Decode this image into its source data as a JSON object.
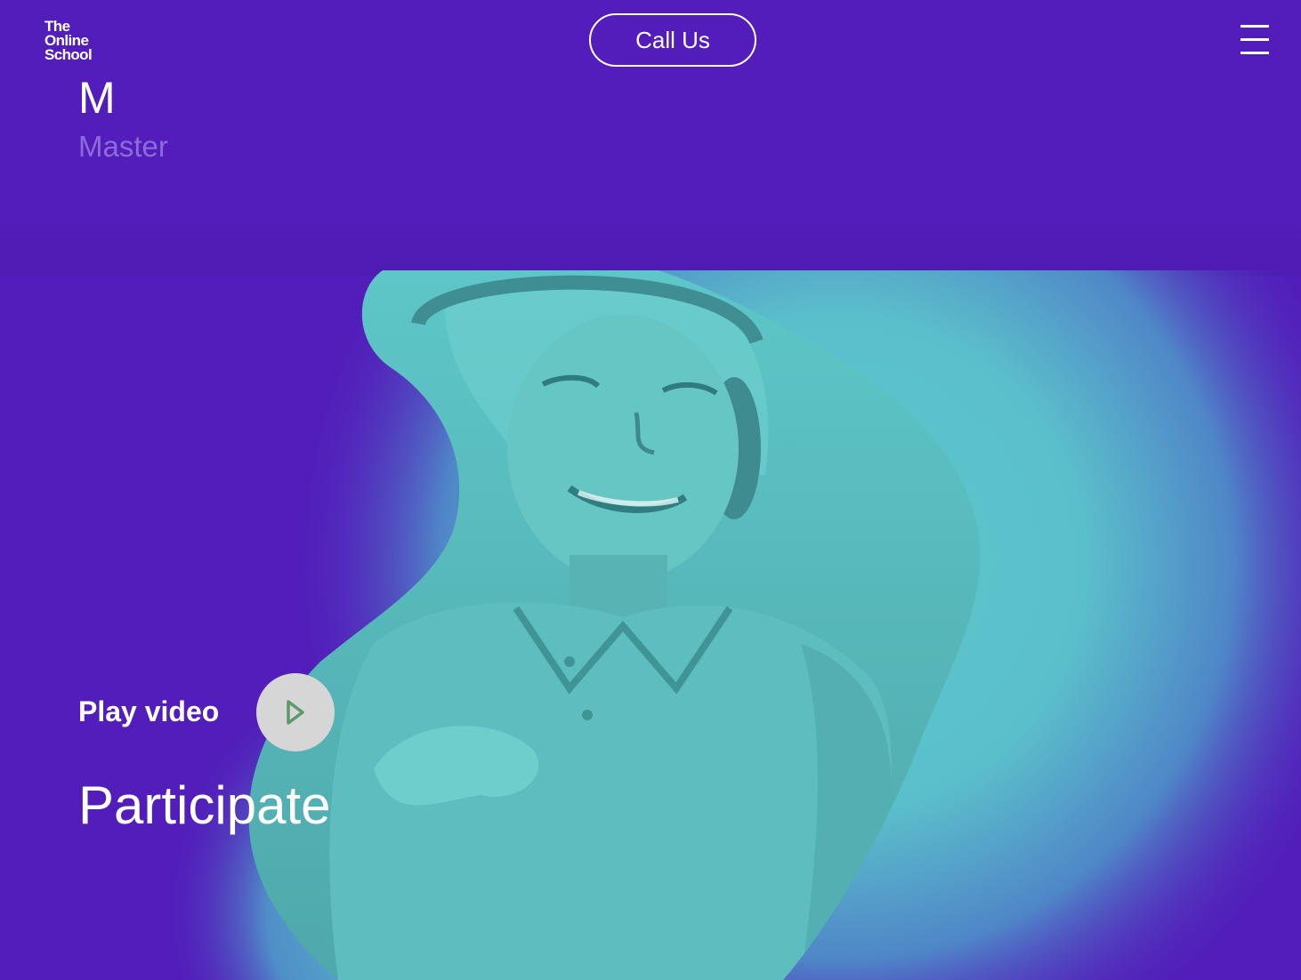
{
  "header": {
    "logo_lines": [
      "The",
      "Online",
      "School"
    ],
    "call_label": "Call Us",
    "menu_icon": "hamburger-menu-icon"
  },
  "level": {
    "letter": "M",
    "label": "Master"
  },
  "hero": {
    "play_label": "Play video",
    "play_icon": "play-triangle-icon",
    "heading": "Participate",
    "image_description_icon": "hero-photo"
  },
  "colors": {
    "background": "#521DBA",
    "level_label": "#8E6BDB",
    "teal": "#5CC8CB",
    "play_button": "#D6D6D6",
    "play_icon": "#5A9A6C"
  }
}
